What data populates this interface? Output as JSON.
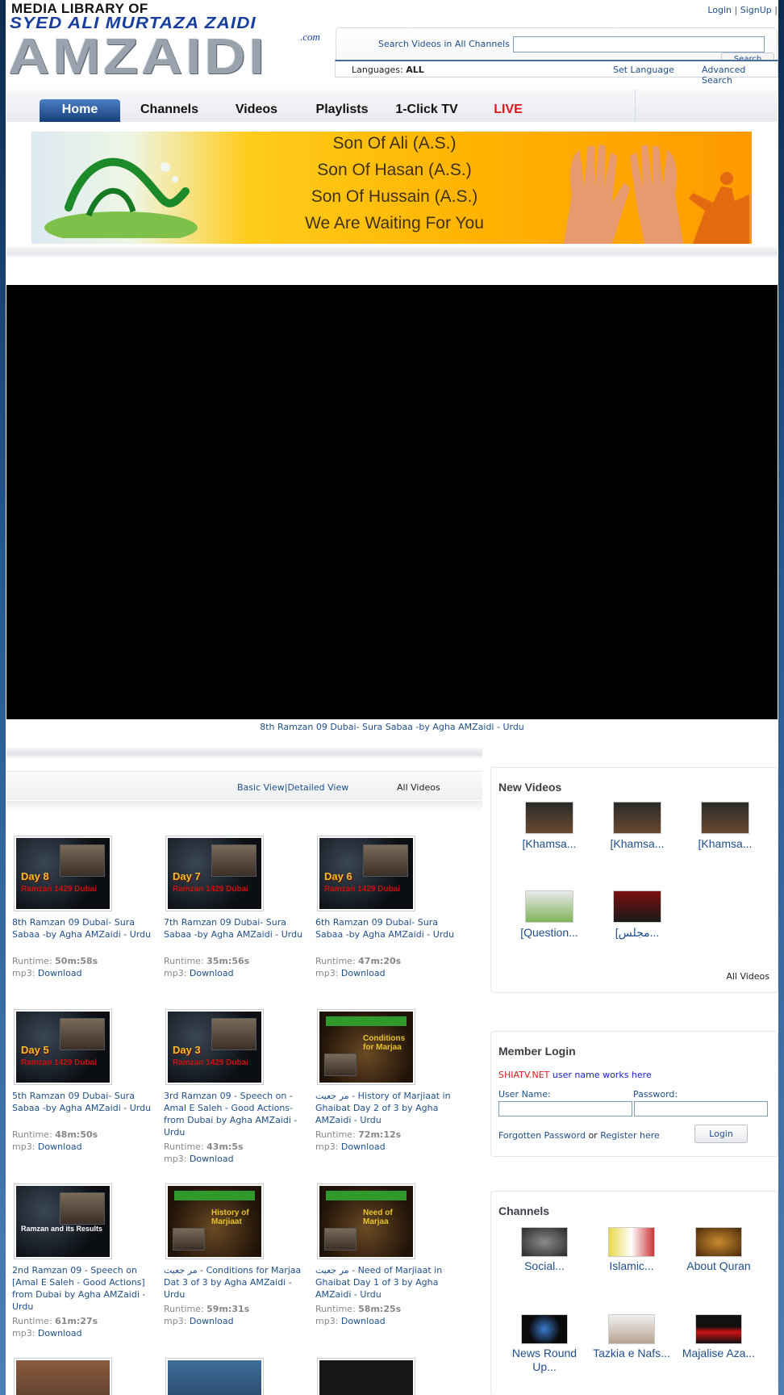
{
  "header": {
    "logo_line1": "MEDIA LIBRARY OF",
    "logo_line2": "SYED ALI MURTAZA ZAIDI",
    "logo_main": "AMZAIDI",
    "logo_suffix": ".com",
    "top_links": {
      "login": "Login",
      "sep": "|",
      "signup": "SignUp",
      "sep2": "|"
    }
  },
  "search": {
    "label": "Search Videos in All Channels",
    "value": "",
    "button": "Search",
    "languages_label": "Languages:",
    "languages_value": "ALL",
    "set_language": "Set Language",
    "advanced_search": "Advanced Search"
  },
  "nav": {
    "tabs": [
      {
        "label": "Home"
      },
      {
        "label": "Channels"
      },
      {
        "label": "Videos"
      },
      {
        "label": "Playlists"
      },
      {
        "label": "1-Click TV"
      },
      {
        "label": "LIVE"
      }
    ]
  },
  "banner": {
    "lines": [
      "Son Of Ali (A.S.)",
      "Son Of Hasan (A.S.)",
      "Son Of Hussain (A.S.)",
      "We Are Waiting For You"
    ]
  },
  "player": {
    "caption": "8th Ramzan 09 Dubai- Sura Sabaa -by Agha AMZaidi - Urdu"
  },
  "view_bar": {
    "basic_view": "Basic View",
    "sep": "|",
    "detailed_view": "Detailed View",
    "all_videos": "All Videos"
  },
  "videos": [
    {
      "title": "8th Ramzan 09 Dubai- Sura Sabaa -by Agha AMZaidi - Urdu",
      "runtime_label": "Runtime:",
      "runtime": "50m:58s",
      "dl_label": "mp3:",
      "dl": "Download",
      "thumb_day": "Day 8",
      "thumb_sub": "Ramzan 1429 Dubai"
    },
    {
      "title": "7th Ramzan 09 Dubai- Sura Sabaa -by Agha AMZaidi - Urdu",
      "runtime_label": "Runtime:",
      "runtime": "35m:56s",
      "dl_label": "mp3:",
      "dl": "Download",
      "thumb_day": "Day 7",
      "thumb_sub": "Ramzan 1429 Dubai"
    },
    {
      "title": "6th Ramzan 09 Dubai- Sura Sabaa -by Agha AMZaidi - Urdu",
      "runtime_label": "Runtime:",
      "runtime": "47m:20s",
      "dl_label": "mp3:",
      "dl": "Download",
      "thumb_day": "Day 6",
      "thumb_sub": "Ramzan 1429 Dubai"
    },
    {
      "title": "5th Ramzan 09 Dubai- Sura Sabaa -by Agha AMZaidi - Urdu",
      "runtime_label": "Runtime:",
      "runtime": "48m:50s",
      "dl_label": "mp3:",
      "dl": "Download",
      "thumb_day": "Day 5",
      "thumb_sub": "Ramzan 1429 Dubai"
    },
    {
      "title": "3rd Ramzan 09 - Speech on -Amal E Saleh - Good Actions- from Dubai by Agha AMZaidi - Urdu",
      "runtime_label": "Runtime:",
      "runtime": "43m:5s",
      "dl_label": "mp3:",
      "dl": "Download",
      "thumb_day": "Day 3",
      "thumb_sub": "Ramzan 1429 Dubai"
    },
    {
      "title": "مر جعیت - History of Marjiaat in Ghaibat Day 2 of 3 by Agha AMZaidi - Urdu",
      "runtime_label": "Runtime:",
      "runtime": "72m:12s",
      "dl_label": "mp3:",
      "dl": "Download",
      "thumb_day": "",
      "thumb_sub": "Conditions for Marjaa"
    },
    {
      "title": "2nd Ramzan 09 - Speech on [Amal E Saleh - Good Actions] from Dubai by Agha AMZaidi - Urdu",
      "runtime_label": "Runtime:",
      "runtime": "61m:27s",
      "dl_label": "mp3:",
      "dl": "Download",
      "thumb_day": "",
      "thumb_sub": "Ramzan and its Results"
    },
    {
      "title": "مر جعیت - Conditions for Marjaa Dat 3 of 3 by Agha AMZaidi - Urdu",
      "runtime_label": "Runtime:",
      "runtime": "59m:31s",
      "dl_label": "mp3:",
      "dl": "Download",
      "thumb_day": "",
      "thumb_sub": "History of Marjiaat"
    },
    {
      "title": "مر جعیت - Need of Marjiaat in Ghaibat Day 1 of 3 by Agha AMZaidi - Urdu",
      "runtime_label": "Runtime:",
      "runtime": "58m:25s",
      "dl_label": "mp3:",
      "dl": "Download",
      "thumb_day": "",
      "thumb_sub": "Need of Marjaa"
    }
  ],
  "new_videos": {
    "title": "New Videos",
    "items": [
      {
        "label": "[Khamsa..."
      },
      {
        "label": "[Khamsa..."
      },
      {
        "label": "[Khamsa..."
      },
      {
        "label": "[Question..."
      },
      {
        "label": "[مجلس..."
      }
    ],
    "all_videos": "All Videos"
  },
  "member_login": {
    "title": "Member Login",
    "site": "SHIATV.NET",
    "note": "user name works here",
    "username_label": "User Name:",
    "password_label": "Password:",
    "username_value": "",
    "password_value": "",
    "forgot": "Forgotten Password",
    "or": "or",
    "register": "Register here",
    "login_button": "Login"
  },
  "channels": {
    "title": "Channels",
    "items": [
      {
        "label": "Social..."
      },
      {
        "label": "Islamic..."
      },
      {
        "label": "About Quran"
      },
      {
        "label": "News Round Up..."
      },
      {
        "label": "Tazkia e Nafs..."
      },
      {
        "label": "Majalise Aza..."
      }
    ]
  },
  "colors": {
    "link": "#1f4f8a",
    "live": "#e0161b",
    "tab_active": "#2a5a9a",
    "border_blue": "#25588f"
  }
}
